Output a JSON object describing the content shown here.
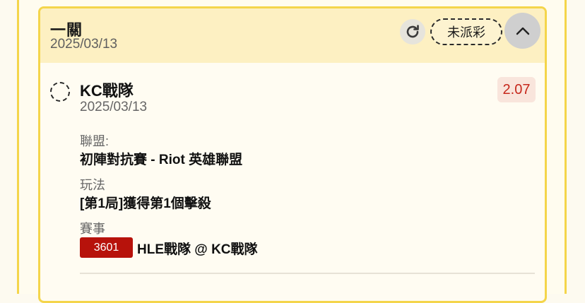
{
  "card": {
    "title": "一關",
    "date": "2025/03/13",
    "status": "未派彩",
    "refresh_icon": "refresh-icon",
    "collapse_icon": "chevron-up-icon"
  },
  "selection": {
    "team": "KC戰隊",
    "date": "2025/03/13",
    "odds": "2.07",
    "league_label": "聯盟:",
    "league_value": "初陣對抗賽 - Riot 英雄聯盟",
    "market_label": "玩法",
    "market_value": "[第1局]獲得第1個擊殺",
    "event_label": "賽事",
    "event_id": "3601",
    "event_name": "HLE戰隊 @ KC戰隊"
  },
  "colors": {
    "accent_border": "#f4d54b",
    "header_bg": "#fdf0c2",
    "odds_text": "#c6281c",
    "event_badge": "#b7120b"
  }
}
